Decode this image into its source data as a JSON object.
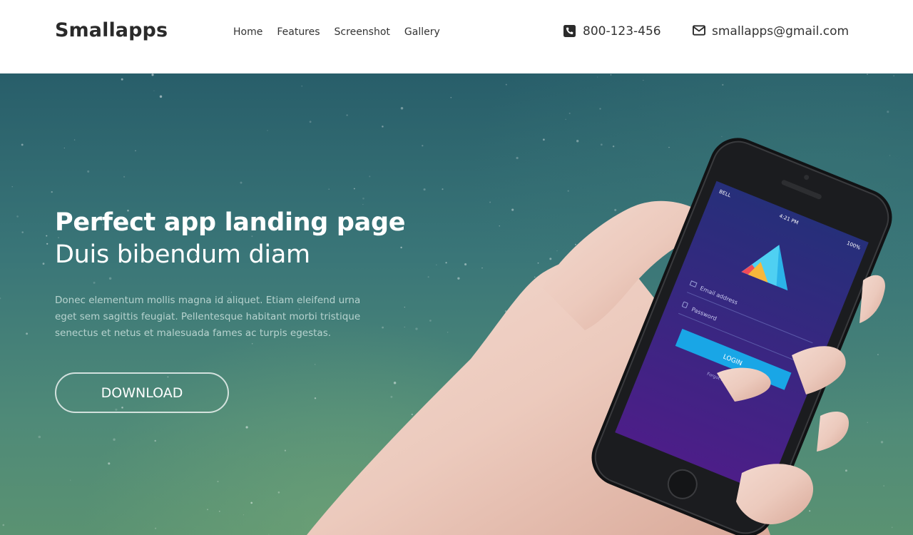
{
  "header": {
    "brand": "Smallapps",
    "nav": [
      {
        "label": "Home"
      },
      {
        "label": "Features"
      },
      {
        "label": "Screenshot"
      },
      {
        "label": "Gallery"
      }
    ],
    "phone": {
      "icon": "phone-square-icon",
      "text": "800-123-456"
    },
    "email": {
      "icon": "envelope-icon",
      "text": "smallapps@gmail.com"
    }
  },
  "hero": {
    "title": "Perfect app landing page",
    "subtitle": "Duis bibendum diam",
    "description": "Donec elementum mollis magna id aliquet. Etiam eleifend urna eget sem sagittis feugiat. Pellentesque habitant morbi tristique senectus et netus et malesuada fames ac turpis egestas.",
    "button_label": "DOWNLOAD"
  },
  "phone_screen": {
    "carrier": "BELL",
    "time": "4:21 PM",
    "battery": "100%",
    "email_label": "Email address",
    "password_label": "Password",
    "login_label": "LOGIN",
    "forgot_label": "Forgot Password?"
  },
  "colors": {
    "login_button": "#19a6e6",
    "screen_top": "#2a2f7c",
    "screen_bottom": "#4a1f86",
    "hero_top": "#285e6a",
    "hero_bottom": "#5a9272"
  }
}
